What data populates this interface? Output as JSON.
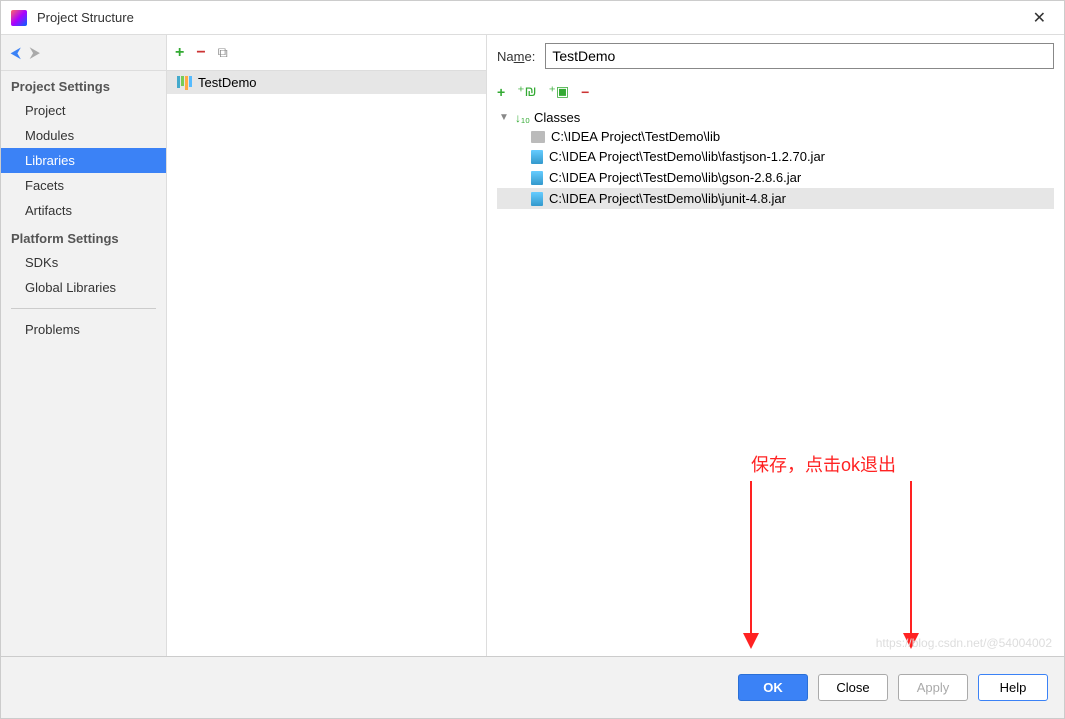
{
  "window": {
    "title": "Project Structure",
    "close": "✕"
  },
  "sidebar": {
    "section1_header": "Project Settings",
    "section1_items": [
      "Project",
      "Modules",
      "Libraries",
      "Facets",
      "Artifacts"
    ],
    "section1_selected": 2,
    "section2_header": "Platform Settings",
    "section2_items": [
      "SDKs",
      "Global Libraries"
    ],
    "section3_items": [
      "Problems"
    ]
  },
  "mid": {
    "library_name": "TestDemo"
  },
  "detail": {
    "name_label_prefix": "Na",
    "name_label_underlined": "m",
    "name_label_suffix": "e:",
    "name_value": "TestDemo",
    "tree_root": "Classes",
    "folder": "C:\\IDEA Project\\TestDemo\\lib",
    "jars": [
      "C:\\IDEA Project\\TestDemo\\lib\\fastjson-1.2.70.jar",
      "C:\\IDEA Project\\TestDemo\\lib\\gson-2.8.6.jar",
      "C:\\IDEA Project\\TestDemo\\lib\\junit-4.8.jar"
    ],
    "selected_jar": 2
  },
  "footer": {
    "ok": "OK",
    "close": "Close",
    "apply": "Apply",
    "help": "Help"
  },
  "annotation": {
    "text": "保存，点击ok退出"
  },
  "watermark": "https://blog.csdn.net/@54004002"
}
